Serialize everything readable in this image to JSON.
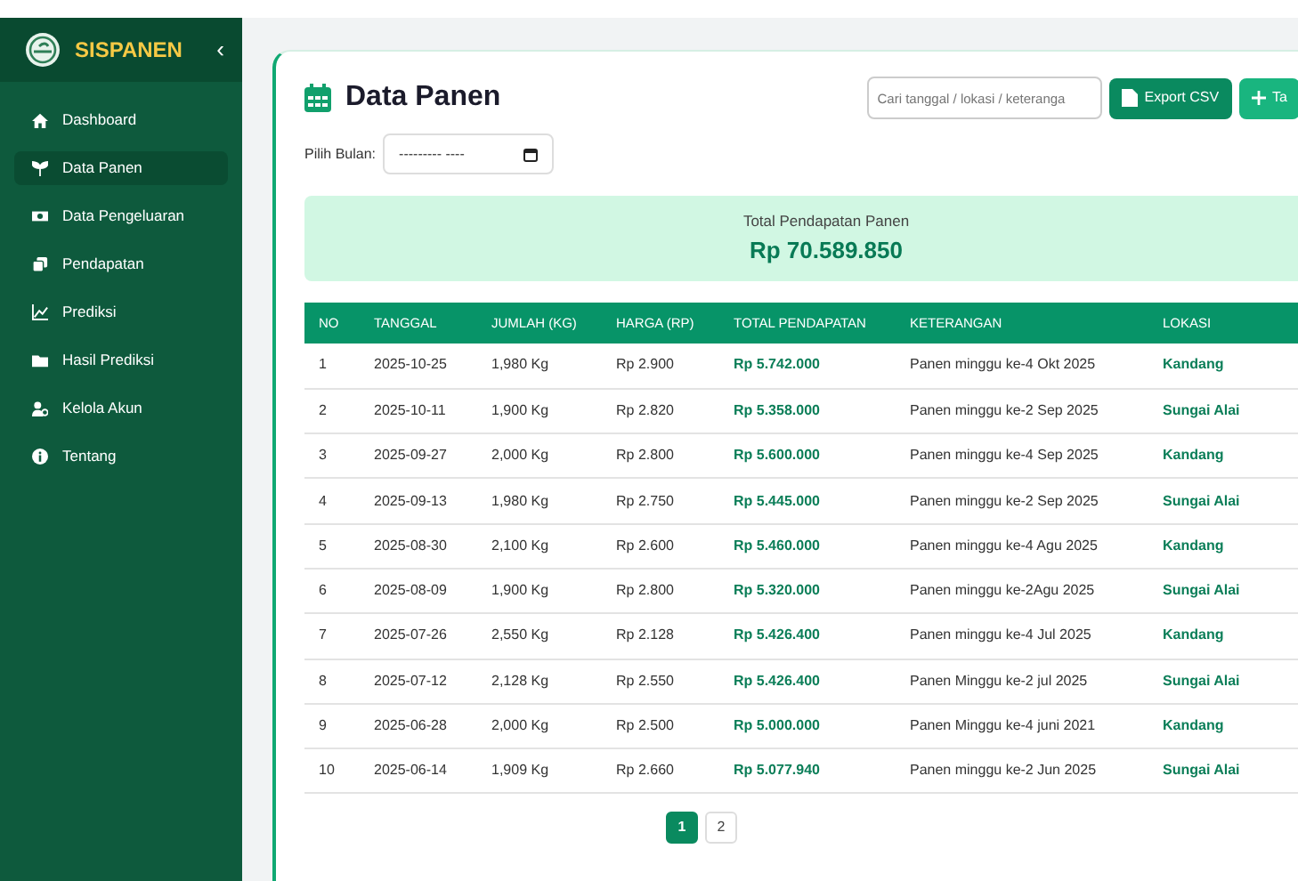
{
  "sidebar": {
    "brand": "SISPANEN",
    "collapse": "‹",
    "items": [
      {
        "label": "Dashboard",
        "selected": false
      },
      {
        "label": "Data Panen",
        "selected": true
      },
      {
        "label": "Data Pengeluaran",
        "selected": false
      },
      {
        "label": "Pendapatan",
        "selected": false
      },
      {
        "label": "Prediksi",
        "selected": false
      },
      {
        "label": "Hasil Prediksi",
        "selected": false
      },
      {
        "label": "Kelola Akun",
        "selected": false
      },
      {
        "label": "Tentang",
        "selected": false
      }
    ]
  },
  "page": {
    "title": "Data Panen",
    "search": {
      "placeholder": "Cari tanggal / lokasi / keteranga"
    },
    "buttons": [
      {
        "label": "Export CSV",
        "kind": "export"
      },
      {
        "label": "Ta",
        "kind": "add"
      }
    ],
    "month_label": "Pilih Bulan:",
    "month_value": "--------- ----"
  },
  "summary": {
    "label": "Total Pendapatan Panen",
    "value": "Rp 70.589.850"
  },
  "table": {
    "columns": [
      "NO",
      "TANGGAL",
      "JUMLAH (KG)",
      "HARGA (RP)",
      "TOTAL PENDAPATAN",
      "KETERANGAN",
      "LOKASI"
    ],
    "rows": [
      [
        "1",
        "2025-10-25",
        "1,980 Kg",
        "Rp 2.900",
        "Rp 5.742.000",
        "Panen minggu ke-4 Okt 2025",
        "Kandang"
      ],
      [
        "2",
        "2025-10-11",
        "1,900 Kg",
        "Rp 2.820",
        "Rp 5.358.000",
        "Panen minggu ke-2 Sep 2025",
        "Sungai Alai"
      ],
      [
        "3",
        "2025-09-27",
        "2,000 Kg",
        "Rp 2.800",
        "Rp 5.600.000",
        "Panen minggu ke-4 Sep 2025",
        "Kandang"
      ],
      [
        "4",
        "2025-09-13",
        "1,980 Kg",
        "Rp 2.750",
        "Rp 5.445.000",
        "Panen minggu ke-2 Sep 2025",
        "Sungai Alai"
      ],
      [
        "5",
        "2025-08-30",
        "2,100 Kg",
        "Rp 2.600",
        "Rp 5.460.000",
        "Panen minggu ke-4 Agu 2025",
        "Kandang"
      ],
      [
        "6",
        "2025-08-09",
        "1,900 Kg",
        "Rp 2.800",
        "Rp 5.320.000",
        "Panen minggu ke-2Agu 2025",
        "Sungai Alai"
      ],
      [
        "7",
        "2025-07-26",
        "2,550 Kg",
        "Rp 2.128",
        "Rp 5.426.400",
        "Panen minggu ke-4 Jul 2025",
        "Kandang"
      ],
      [
        "8",
        "2025-07-12",
        "2,128 Kg",
        "Rp 2.550",
        "Rp 5.426.400",
        "Panen Minggu ke-2 jul 2025",
        "Sungai Alai"
      ],
      [
        "9",
        "2025-06-28",
        "2,000 Kg",
        "Rp 2.500",
        "Rp 5.000.000",
        "Panen Minggu ke-4 juni 2021",
        "Kandang"
      ],
      [
        "10",
        "2025-06-14",
        "1,909 Kg",
        "Rp 2.660",
        "Rp 5.077.940",
        "Panen minggu ke-2 Jun 2025",
        "Sungai Alai"
      ]
    ]
  },
  "pagination": [
    {
      "label": "1",
      "selected": true
    },
    {
      "label": "2",
      "selected": false
    }
  ]
}
